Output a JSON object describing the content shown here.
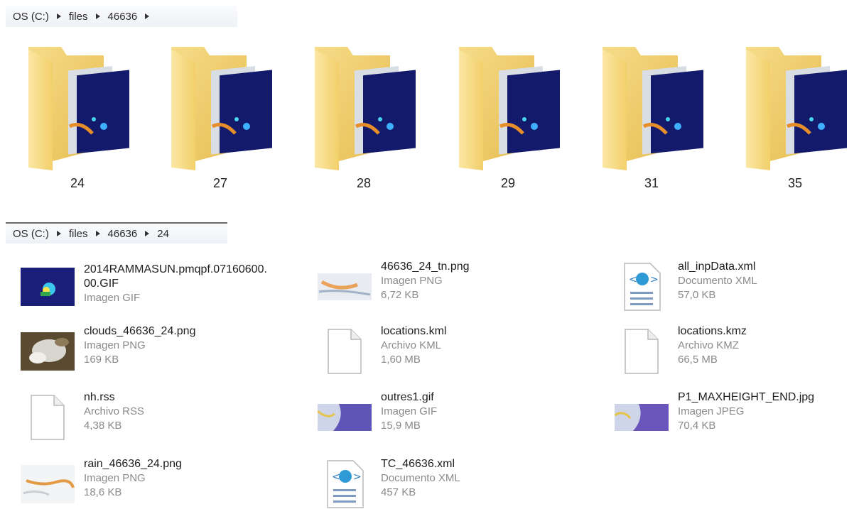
{
  "breadcrumb_top": {
    "items": [
      "OS (C:)",
      "files",
      "46636"
    ]
  },
  "folders": [
    {
      "name": "24",
      "icon": "folder-icon"
    },
    {
      "name": "27",
      "icon": "folder-icon"
    },
    {
      "name": "28",
      "icon": "folder-icon"
    },
    {
      "name": "29",
      "icon": "folder-icon"
    },
    {
      "name": "31",
      "icon": "folder-icon"
    },
    {
      "name": "35",
      "icon": "folder-icon"
    }
  ],
  "breadcrumb_bottom": {
    "items": [
      "OS (C:)",
      "files",
      "46636",
      "24"
    ]
  },
  "files": [
    {
      "name_line1": "2014RAMMASUN.pmqpf.07160600.",
      "name_line2": "00.GIF",
      "type": "Imagen GIF",
      "size": "",
      "icon": "radar-image-thumbnail"
    },
    {
      "name_line1": "46636_24_tn.png",
      "name_line2": "",
      "type": "Imagen PNG",
      "size": "6,72 KB",
      "icon": "map-image-thumbnail"
    },
    {
      "name_line1": "all_inpData.xml",
      "name_line2": "",
      "type": "Documento XML",
      "size": "57,0 KB",
      "icon": "xml-document-icon"
    },
    {
      "name_line1": "clouds_46636_24.png",
      "name_line2": "",
      "type": "Imagen PNG",
      "size": "169 KB",
      "icon": "satellite-image-thumbnail"
    },
    {
      "name_line1": "locations.kml",
      "name_line2": "",
      "type": "Archivo KML",
      "size": "1,60 MB",
      "icon": "blank-file-icon"
    },
    {
      "name_line1": "locations.kmz",
      "name_line2": "",
      "type": "Archivo KMZ",
      "size": "66,5 MB",
      "icon": "blank-file-icon"
    },
    {
      "name_line1": "nh.rss",
      "name_line2": "",
      "type": "Archivo RSS",
      "size": "4,38 KB",
      "icon": "blank-file-icon"
    },
    {
      "name_line1": "outres1.gif",
      "name_line2": "",
      "type": "Imagen GIF",
      "size": "15,9 MB",
      "icon": "map-purple-thumbnail"
    },
    {
      "name_line1": "P1_MAXHEIGHT_END.jpg",
      "name_line2": "",
      "type": "Imagen JPEG",
      "size": "70,4 KB",
      "icon": "map-purple-thumbnail"
    },
    {
      "name_line1": "rain_46636_24.png",
      "name_line2": "",
      "type": "Imagen PNG",
      "size": "18,6 KB",
      "icon": "map-image-thumbnail"
    },
    {
      "name_line1": "TC_46636.xml",
      "name_line2": "",
      "type": "Documento XML",
      "size": "457 KB",
      "icon": "xml-document-icon"
    }
  ]
}
